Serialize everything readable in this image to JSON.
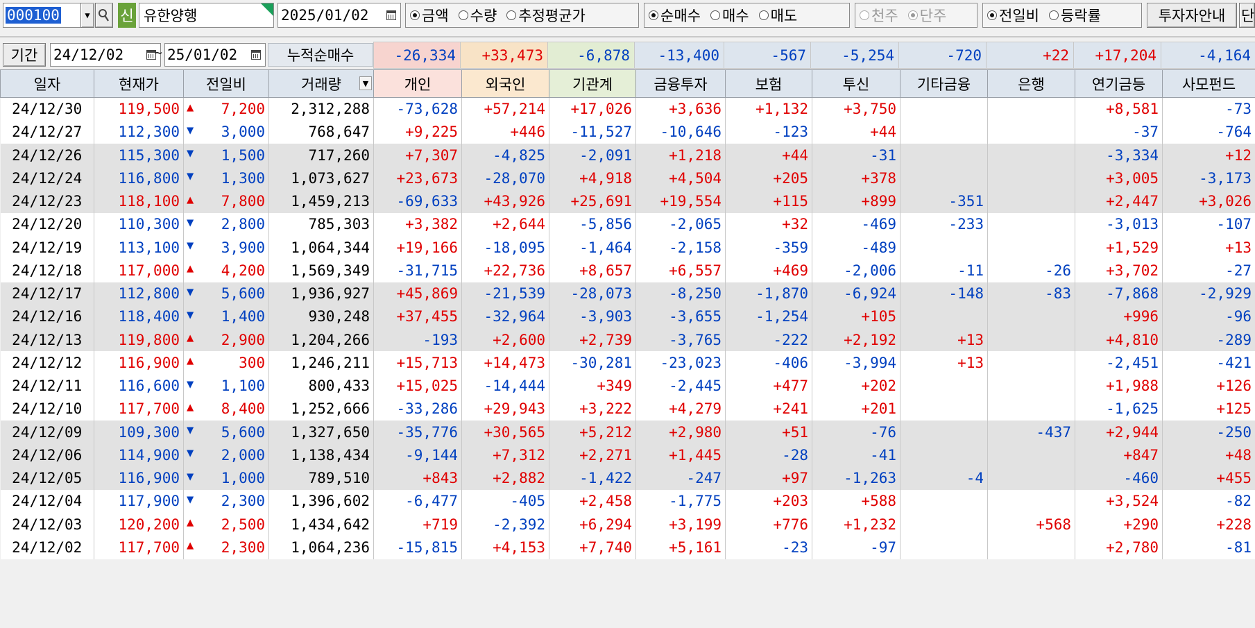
{
  "toolbar": {
    "stock_code": "000100",
    "credit_badge": "신",
    "stock_name": "유한양행",
    "date": "2025/01/02",
    "unit_radios": [
      {
        "label": "금액",
        "checked": true
      },
      {
        "label": "수량",
        "checked": false
      },
      {
        "label": "추정평균가",
        "checked": false
      }
    ],
    "trade_radios": [
      {
        "label": "순매수",
        "checked": true
      },
      {
        "label": "매수",
        "checked": false
      },
      {
        "label": "매도",
        "checked": false
      }
    ],
    "scale_radios": [
      {
        "label": "천주",
        "checked": false
      },
      {
        "label": "단주",
        "checked": true
      }
    ],
    "compare_radios": [
      {
        "label": "전일비",
        "checked": true
      },
      {
        "label": "등락률",
        "checked": false
      }
    ],
    "guide_button": "투자자안내",
    "cut_button": "단"
  },
  "filter": {
    "period_label": "기간",
    "from_date": "24/12/02",
    "to_date": "25/01/02",
    "tilde": "~",
    "cumulative_label": "누적순매수",
    "sums": [
      "-26,334",
      "+33,473",
      "-6,878",
      "-13,400",
      "-567",
      "-5,254",
      "-720",
      "+22",
      "+17,204",
      "-4,164"
    ]
  },
  "table": {
    "columns": [
      "일자",
      "현재가",
      "전일비",
      "거래량",
      "개인",
      "외국인",
      "기관계",
      "금융투자",
      "보험",
      "투신",
      "기타금융",
      "은행",
      "연기금등",
      "사모펀드"
    ],
    "rows": [
      {
        "date": "24/12/30",
        "price": "119,500",
        "dir": "up",
        "change": "7,200",
        "volume": "2,312,288",
        "vals": [
          "-73,628",
          "+57,214",
          "+17,026",
          "+3,636",
          "+1,132",
          "+3,750",
          "",
          "",
          "+8,581",
          "-73"
        ]
      },
      {
        "date": "24/12/27",
        "price": "112,300",
        "dir": "down",
        "change": "3,000",
        "volume": "768,647",
        "vals": [
          "+9,225",
          "+446",
          "-11,527",
          "-10,646",
          "-123",
          "+44",
          "",
          "",
          "-37",
          "-764"
        ]
      },
      {
        "date": "24/12/26",
        "price": "115,300",
        "dir": "down",
        "change": "1,500",
        "volume": "717,260",
        "vals": [
          "+7,307",
          "-4,825",
          "-2,091",
          "+1,218",
          "+44",
          "-31",
          "",
          "",
          "-3,334",
          "+12"
        ]
      },
      {
        "date": "24/12/24",
        "price": "116,800",
        "dir": "down",
        "change": "1,300",
        "volume": "1,073,627",
        "vals": [
          "+23,673",
          "-28,070",
          "+4,918",
          "+4,504",
          "+205",
          "+378",
          "",
          "",
          "+3,005",
          "-3,173"
        ]
      },
      {
        "date": "24/12/23",
        "price": "118,100",
        "dir": "up",
        "change": "7,800",
        "volume": "1,459,213",
        "vals": [
          "-69,633",
          "+43,926",
          "+25,691",
          "+19,554",
          "+115",
          "+899",
          "-351",
          "",
          "+2,447",
          "+3,026"
        ]
      },
      {
        "date": "24/12/20",
        "price": "110,300",
        "dir": "down",
        "change": "2,800",
        "volume": "785,303",
        "vals": [
          "+3,382",
          "+2,644",
          "-5,856",
          "-2,065",
          "+32",
          "-469",
          "-233",
          "",
          "-3,013",
          "-107"
        ]
      },
      {
        "date": "24/12/19",
        "price": "113,100",
        "dir": "down",
        "change": "3,900",
        "volume": "1,064,344",
        "vals": [
          "+19,166",
          "-18,095",
          "-1,464",
          "-2,158",
          "-359",
          "-489",
          "",
          "",
          "+1,529",
          "+13"
        ]
      },
      {
        "date": "24/12/18",
        "price": "117,000",
        "dir": "up",
        "change": "4,200",
        "volume": "1,569,349",
        "vals": [
          "-31,715",
          "+22,736",
          "+8,657",
          "+6,557",
          "+469",
          "-2,006",
          "-11",
          "-26",
          "+3,702",
          "-27"
        ]
      },
      {
        "date": "24/12/17",
        "price": "112,800",
        "dir": "down",
        "change": "5,600",
        "volume": "1,936,927",
        "vals": [
          "+45,869",
          "-21,539",
          "-28,073",
          "-8,250",
          "-1,870",
          "-6,924",
          "-148",
          "-83",
          "-7,868",
          "-2,929"
        ]
      },
      {
        "date": "24/12/16",
        "price": "118,400",
        "dir": "down",
        "change": "1,400",
        "volume": "930,248",
        "vals": [
          "+37,455",
          "-32,964",
          "-3,903",
          "-3,655",
          "-1,254",
          "+105",
          "",
          "",
          "+996",
          "-96"
        ]
      },
      {
        "date": "24/12/13",
        "price": "119,800",
        "dir": "up",
        "change": "2,900",
        "volume": "1,204,266",
        "vals": [
          "-193",
          "+2,600",
          "+2,739",
          "-3,765",
          "-222",
          "+2,192",
          "+13",
          "",
          "+4,810",
          "-289"
        ]
      },
      {
        "date": "24/12/12",
        "price": "116,900",
        "dir": "up",
        "change": "300",
        "volume": "1,246,211",
        "vals": [
          "+15,713",
          "+14,473",
          "-30,281",
          "-23,023",
          "-406",
          "-3,994",
          "+13",
          "",
          "-2,451",
          "-421"
        ]
      },
      {
        "date": "24/12/11",
        "price": "116,600",
        "dir": "down",
        "change": "1,100",
        "volume": "800,433",
        "vals": [
          "+15,025",
          "-14,444",
          "+349",
          "-2,445",
          "+477",
          "+202",
          "",
          "",
          "+1,988",
          "+126"
        ]
      },
      {
        "date": "24/12/10",
        "price": "117,700",
        "dir": "up",
        "change": "8,400",
        "volume": "1,252,666",
        "vals": [
          "-33,286",
          "+29,943",
          "+3,222",
          "+4,279",
          "+241",
          "+201",
          "",
          "",
          "-1,625",
          "+125"
        ]
      },
      {
        "date": "24/12/09",
        "price": "109,300",
        "dir": "down",
        "change": "5,600",
        "volume": "1,327,650",
        "vals": [
          "-35,776",
          "+30,565",
          "+5,212",
          "+2,980",
          "+51",
          "-76",
          "",
          "-437",
          "+2,944",
          "-250"
        ]
      },
      {
        "date": "24/12/06",
        "price": "114,900",
        "dir": "down",
        "change": "2,000",
        "volume": "1,138,434",
        "vals": [
          "-9,144",
          "+7,312",
          "+2,271",
          "+1,445",
          "-28",
          "-41",
          "",
          "",
          "+847",
          "+48"
        ]
      },
      {
        "date": "24/12/05",
        "price": "116,900",
        "dir": "down",
        "change": "1,000",
        "volume": "789,510",
        "vals": [
          "+843",
          "+2,882",
          "-1,422",
          "-247",
          "+97",
          "-1,263",
          "-4",
          "",
          "-460",
          "+455"
        ]
      },
      {
        "date": "24/12/04",
        "price": "117,900",
        "dir": "down",
        "change": "2,300",
        "volume": "1,396,602",
        "vals": [
          "-6,477",
          "-405",
          "+2,458",
          "-1,775",
          "+203",
          "+588",
          "",
          "",
          "+3,524",
          "-82"
        ]
      },
      {
        "date": "24/12/03",
        "price": "120,200",
        "dir": "up",
        "change": "2,500",
        "volume": "1,434,642",
        "vals": [
          "+719",
          "-2,392",
          "+6,294",
          "+3,199",
          "+776",
          "+1,232",
          "",
          "+568",
          "+290",
          "+228"
        ]
      },
      {
        "date": "24/12/02",
        "price": "117,700",
        "dir": "up",
        "change": "2,300",
        "volume": "1,064,236",
        "vals": [
          "-15,815",
          "+4,153",
          "+7,740",
          "+5,161",
          "-23",
          "-97",
          "",
          "",
          "+2,780",
          "-81"
        ]
      }
    ]
  },
  "colors": {
    "up": "#e00000",
    "down": "#0040c0",
    "header_bg": "#dde5ee",
    "alt_row": "#e2e2e2"
  }
}
